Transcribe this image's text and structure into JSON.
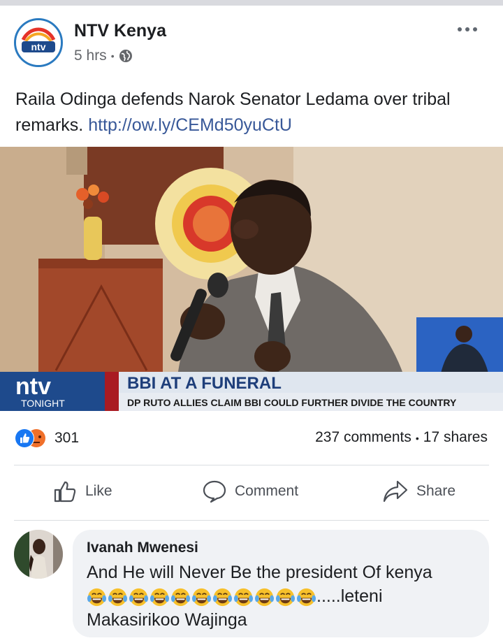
{
  "post": {
    "page_name": "NTV Kenya",
    "time": "5 hrs",
    "separator": "•",
    "text_main": "Raila Odinga defends Narok Senator Ledama over tribal remarks.",
    "link": "http://ow.ly/CEMd50yuCtU",
    "more_icon": "more-options-icon",
    "privacy_icon": "globe-icon"
  },
  "media": {
    "broadcast_logo": "ntv",
    "broadcast_sub": "TONIGHT",
    "headline": "BBI AT A FUNERAL",
    "subheadline": "DP RUTO ALLIES CLAIM BBI COULD FURTHER DIVIDE THE COUNTRY"
  },
  "reactions": {
    "count": "301",
    "types": [
      "like",
      "angry"
    ],
    "comments": "237 comments",
    "dot": "•",
    "shares": "17 shares"
  },
  "actions": {
    "like": "Like",
    "comment": "Comment",
    "share": "Share"
  },
  "comment": {
    "author": "Ivanah Mwenesi",
    "line1": "And He will Never Be the president Of kenya",
    "emoji_count": 11,
    "after_emojis": ".....leteni",
    "line3": "Makasirikoo Wajinga"
  },
  "colors": {
    "link": "#385898",
    "like_blue": "#1877f2",
    "angry_orange": "#f0702a",
    "ntv_blue": "#1e4a8c",
    "emoji_yellow": "#f7c02b"
  }
}
